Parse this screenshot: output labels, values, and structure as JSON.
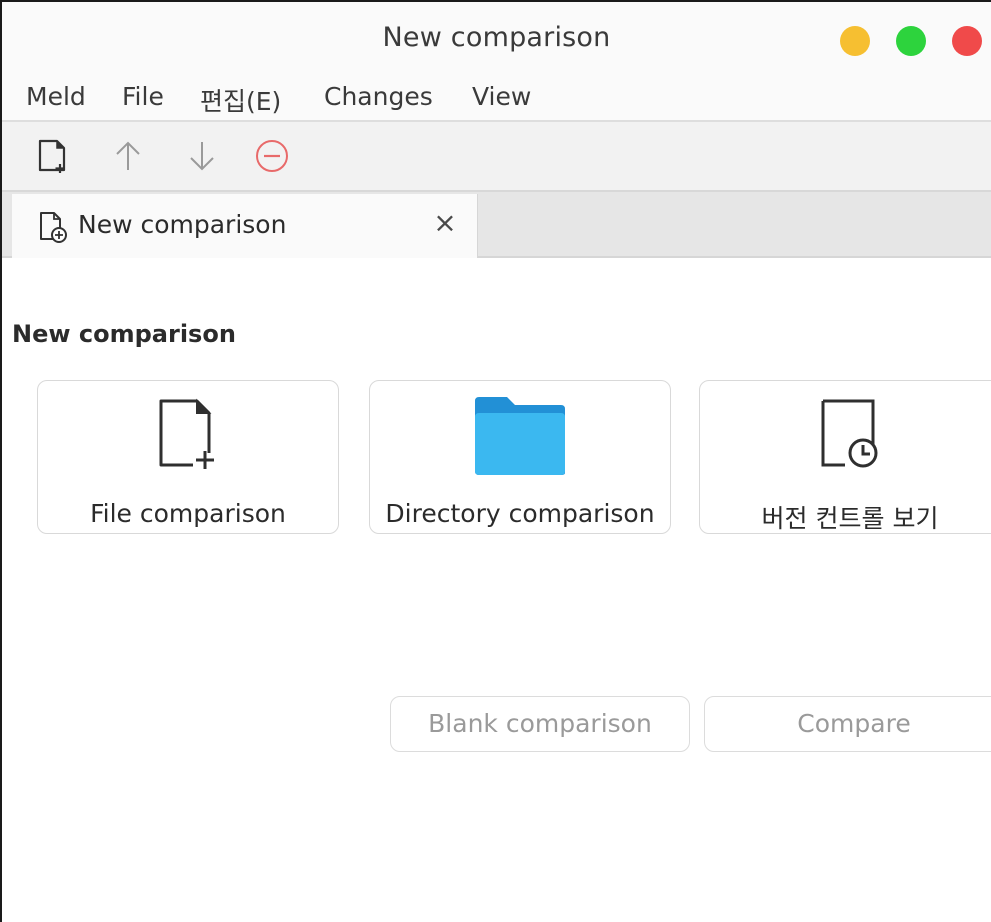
{
  "window": {
    "title": "New comparison"
  },
  "menubar": {
    "items": [
      {
        "label": "Meld"
      },
      {
        "label": "File"
      },
      {
        "label": "편집(E)"
      },
      {
        "label": "Changes"
      },
      {
        "label": "View"
      }
    ]
  },
  "toolbar": {
    "buttons": [
      {
        "icon": "new-comparison-icon"
      },
      {
        "icon": "arrow-up-icon"
      },
      {
        "icon": "arrow-down-icon"
      },
      {
        "icon": "stop-icon",
        "color": "#e86a6a"
      }
    ]
  },
  "tabs": [
    {
      "label": "New comparison",
      "close": "×",
      "icon": "new-document-icon"
    }
  ],
  "main": {
    "section_title": "New comparison",
    "cards": [
      {
        "label": "File comparison",
        "icon": "file-add-icon"
      },
      {
        "label": "Directory comparison",
        "icon": "folder-icon",
        "color": "#2aa7e8"
      },
      {
        "label": "버전 컨트롤 보기",
        "icon": "version-control-icon"
      }
    ],
    "buttons": {
      "blank": "Blank comparison",
      "compare": "Compare"
    }
  }
}
